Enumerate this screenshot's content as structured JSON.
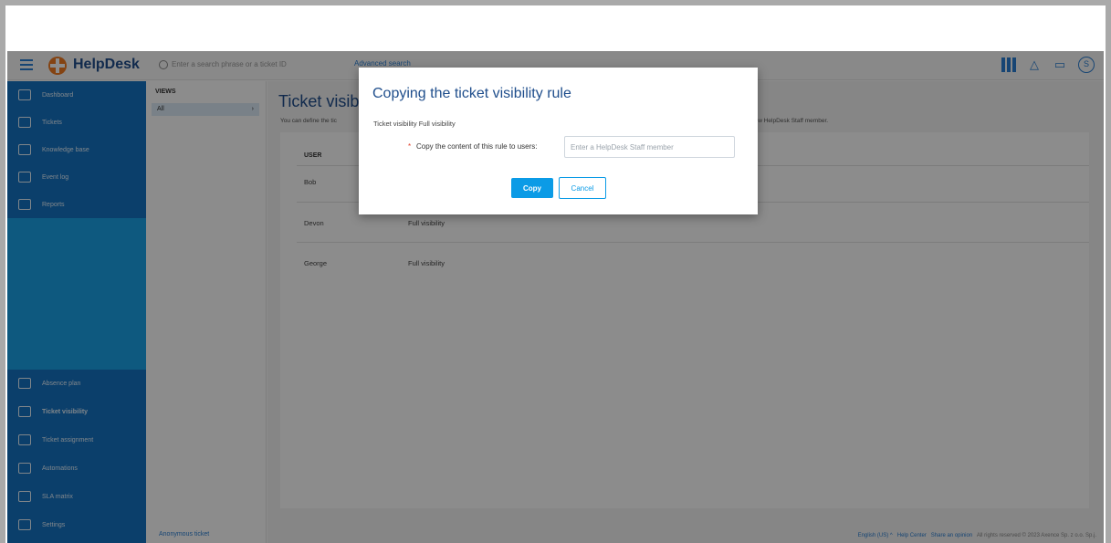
{
  "header": {
    "app_name": "HelpDesk",
    "search_placeholder": "Enter a search phrase or a ticket ID",
    "advanced_search": "Advanced search"
  },
  "sidebar": {
    "items": [
      {
        "label": "Dashboard",
        "icon": "dashboard-icon"
      },
      {
        "label": "Tickets",
        "icon": "tickets-icon"
      },
      {
        "label": "Knowledge base",
        "icon": "knowledge-base-icon"
      },
      {
        "label": "Event log",
        "icon": "event-log-icon"
      },
      {
        "label": "Reports",
        "icon": "reports-icon"
      }
    ],
    "bottom_items": [
      {
        "label": "Absence plan",
        "icon": "absence-plan-icon"
      },
      {
        "label": "Ticket visibility",
        "icon": "ticket-visibility-icon"
      },
      {
        "label": "Ticket assignment",
        "icon": "ticket-assignment-icon"
      },
      {
        "label": "Automations",
        "icon": "automations-icon"
      },
      {
        "label": "SLA matrix",
        "icon": "sla-matrix-icon"
      },
      {
        "label": "Settings",
        "icon": "settings-icon"
      }
    ]
  },
  "views": {
    "title": "VIEWS",
    "all": "All",
    "anonymous": "Anonymous ticket"
  },
  "main": {
    "title": "Ticket visib",
    "description": "You can define the tic",
    "description_tail": "new HelpDesk Staff member.",
    "column_user": "USER",
    "rows": [
      {
        "user": "Bob",
        "visibility": ""
      },
      {
        "user": "Devon",
        "visibility": "Full visibility"
      },
      {
        "user": "George",
        "visibility": "Full visibility"
      }
    ]
  },
  "footer": {
    "language": "English (US) ^",
    "help_center": "Help Center",
    "share_opinion": "Share an opinion",
    "copyright": "All rights reserved © 2023 Axence Sp. z o.o. Sp.j."
  },
  "modal": {
    "title": "Copying the ticket visibility rule",
    "info": "Ticket visibility Full visibility",
    "required_mark": "*",
    "field_label": "Copy the content of this rule to users:",
    "field_placeholder": "Enter a HelpDesk Staff member",
    "copy_label": "Copy",
    "cancel_label": "Cancel"
  },
  "colors": {
    "primary": "#0b9be6",
    "sidebar_dark": "#1473c4",
    "sidebar_light": "#1aa3e8",
    "title_blue": "#1f4e8c",
    "logo_orange": "#f07b22"
  }
}
